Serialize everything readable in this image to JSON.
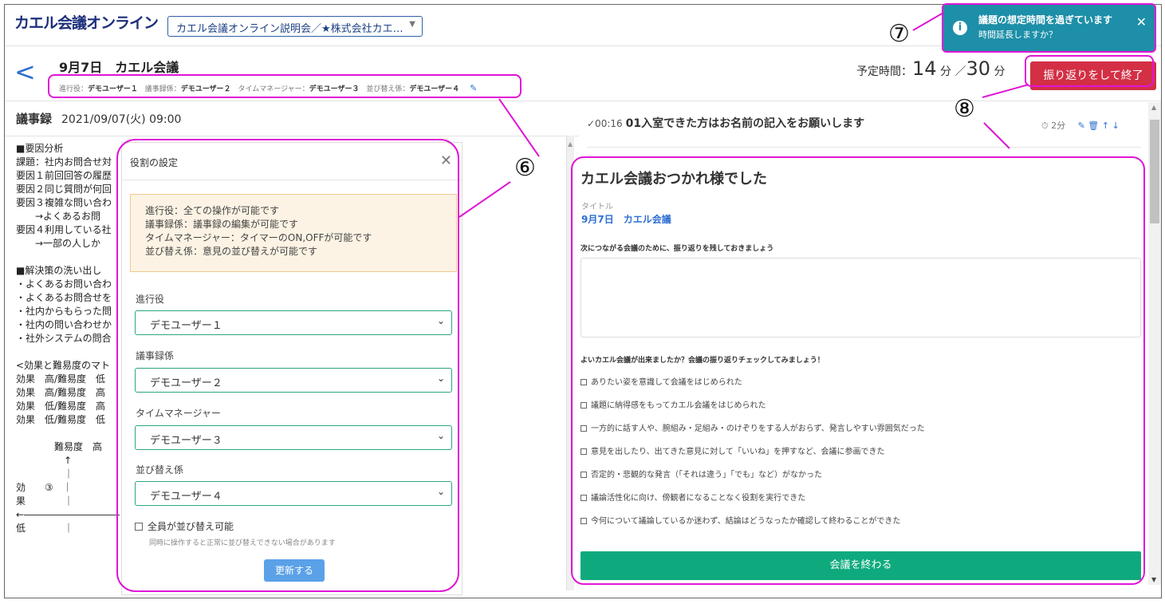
{
  "app": {
    "logo": "カエル会議オンライン",
    "meeting_select": "カエル会議オンライン説明会／★株式会社カエ…"
  },
  "toast": {
    "line1": "議題の想定時間を過ぎています",
    "line2": "時間延長しますか？",
    "icon": "info-icon",
    "close": "✕"
  },
  "header": {
    "title": "9月7日　カエル会議",
    "roles": [
      {
        "role": "進行役：",
        "user": "デモユーザー１"
      },
      {
        "role": "議事録係：",
        "user": "デモユーザー２"
      },
      {
        "role": "タイムマネージャー：",
        "user": "デモユーザー３"
      },
      {
        "role": "並び替え係：",
        "user": "デモユーザー４"
      }
    ],
    "time_label": "予定時間：",
    "time_elapsed": "14",
    "time_unit1": "分",
    "time_sep": "／",
    "time_total": "30",
    "time_unit2": "分",
    "end_button": "振り返りをして終了"
  },
  "minutes": {
    "heading": "議事録",
    "datetime": "2021/09/07(火) 09:00",
    "body": "■要因分析\n課題：社内お問合せ対\n要因１前回回答の履歴\n要因２同じ質問が何回\n要因３複雑な問い合わ\n　　→よくあるお問\n要因４利用している社\n　　→一部の人しか\n\n■解決策の洗い出し\n・よくあるお問い合わ\n・よくあるお問合せを\n・社内からもらった問\n・社内の問い合わせか\n・社外システムの問合\n\n<効果と難易度のマト\n効果　高/難易度　低\n効果　高/難易度　高\n効果　低/難易度　高\n効果　低/難易度　低\n\n　　　　難易度　高\n　　　　　↑\n　　　　　｜\n効　　③　｜\n果　　　　｜\n←――――――――――\n低　　　　｜"
  },
  "role_modal": {
    "title": "役割の設定",
    "notice": [
      "進行役：全ての操作が可能です",
      "議事録係：議事録の編集が可能です",
      "タイムマネージャー：タイマーのON,OFFが可能です",
      "並び替え係：意見の並び替えが可能です"
    ],
    "fields": [
      {
        "label": "進行役",
        "value": "デモユーザー１"
      },
      {
        "label": "議事録係",
        "value": "デモユーザー２"
      },
      {
        "label": "タイムマネージャー",
        "value": "デモユーザー３"
      },
      {
        "label": "並び替え係",
        "value": "デモユーザー４"
      }
    ],
    "checkbox_label": "全員が並び替え可能",
    "checkbox_note": "同時に操作すると正常に並び替えできない場合があります",
    "update_button": "更新する"
  },
  "agenda": {
    "time": "✓00:16",
    "title": "01入室できた方はお名前の記入をお願いします",
    "duration": "2分"
  },
  "recap": {
    "heading": "カエル会議おつかれ様でした",
    "title_label": "タイトル",
    "title_value": "9月7日　カエル会議",
    "reflect_prompt": "次につながる会議のために、振り返りを残しておきましょう",
    "check_prompt": "よいカエル会議が出来ましたか？会議の振り返りチェックしてみましょう！",
    "checks": [
      "ありたい姿を意識して会議をはじめられた",
      "議題に納得感をもってカエル会議をはじめられた",
      "一方的に話す人や、腕組み・足組み・のけぞりをする人がおらず、発言しやすい雰囲気だった",
      "意見を出したり、出てきた意見に対して「いいね」を押すなど、会議に参画できた",
      "否定的・悲観的な発言（「それは違う」「でも」など）がなかった",
      "議論活性化に向け、傍観者になることなく役割を実行できた",
      "今何について議論しているか迷わず、結論はどうなったか確認して終わることができた"
    ],
    "finish_button": "会議を終わる"
  },
  "annotations": [
    "⑥",
    "⑦",
    "⑧"
  ],
  "colors": {
    "accent": "#2f6fd1",
    "danger": "#d32f45",
    "success": "#0eaa7e",
    "toast": "#1d8fa8",
    "highlight": "#e015d6"
  }
}
